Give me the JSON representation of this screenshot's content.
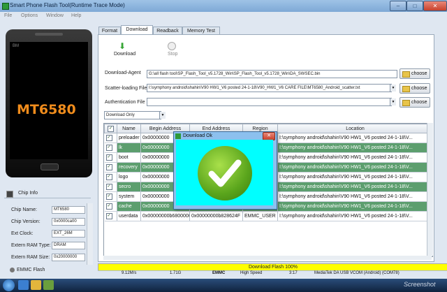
{
  "window": {
    "title": "Smart Phone Flash Tool(Runtime Trace Mode)",
    "minimize": "–",
    "maximize": "□",
    "close": "✕"
  },
  "menu": [
    "File",
    "Options",
    "Window",
    "Help"
  ],
  "phone": {
    "brand": "BM",
    "model": "MT6580"
  },
  "chip_info": {
    "title": "Chip Info",
    "rows": [
      {
        "label": "Chip Name:",
        "value": "MT6580"
      },
      {
        "label": "Chip Version:",
        "value": "0x0000ca00"
      },
      {
        "label": "Ext Clock:",
        "value": "EXT_26M"
      },
      {
        "label": "Extern RAM Type:",
        "value": "DRAM"
      },
      {
        "label": "Extern RAM Size:",
        "value": "0x20000000"
      }
    ],
    "footer": "EMMC Flash"
  },
  "tabs": [
    "Format",
    "Download",
    "Readback",
    "Memory Test"
  ],
  "active_tab": "Download",
  "toolbar": {
    "download": "Download",
    "stop": "Stop",
    "download_icon": "⬇"
  },
  "form": {
    "download_agent": {
      "label": "Download-Agent",
      "value": "G:\\all flash tool\\SP_Flash_Tool_v5.1728_Win\\SP_Flash_Tool_v5.1728_Win\\DA_SWSEC.bin"
    },
    "scatter": {
      "label": "Scatter-loading File",
      "value": "I:\\symphony android\\shahin\\V90 HW1_V6 posted 24-1-18\\V90_HW1_V6 CARE FILE\\MT6580_Android_scatter.txt"
    },
    "auth": {
      "label": "Authentication File",
      "value": ""
    },
    "choose_label": "choose",
    "mode": "Download Only"
  },
  "table": {
    "headers": [
      "",
      "Name",
      "Begin Address",
      "End Address",
      "Region",
      "Location"
    ],
    "rows": [
      {
        "name": "preloader",
        "begin": "0x00000000",
        "end": "",
        "region": "",
        "location": "I:\\symphony android\\shahin\\V90 HW1_V6 posted 24-1-18\\V..."
      },
      {
        "name": "lk",
        "begin": "0x00000000",
        "end": "",
        "region": "",
        "location": "I:\\symphony android\\shahin\\V90 HW1_V6 posted 24-1-18\\V..."
      },
      {
        "name": "boot",
        "begin": "0x00000000",
        "end": "",
        "region": "",
        "location": "I:\\symphony android\\shahin\\V90 HW1_V6 posted 24-1-18\\V..."
      },
      {
        "name": "recovery",
        "begin": "0x00000000",
        "end": "",
        "region": "",
        "location": "I:\\symphony android\\shahin\\V90 HW1_V6 posted 24-1-18\\V..."
      },
      {
        "name": "logo",
        "begin": "0x00000000",
        "end": "",
        "region": "",
        "location": "I:\\symphony android\\shahin\\V90 HW1_V6 posted 24-1-18\\V..."
      },
      {
        "name": "secro",
        "begin": "0x00000000",
        "end": "",
        "region": "",
        "location": "I:\\symphony android\\shahin\\V90 HW1_V6 posted 24-1-18\\V..."
      },
      {
        "name": "system",
        "begin": "0x00000000",
        "end": "",
        "region": "",
        "location": "I:\\symphony android\\shahin\\V90 HW1_V6 posted 24-1-18\\V..."
      },
      {
        "name": "cache",
        "begin": "0x00000000",
        "end": "",
        "region": "",
        "location": "I:\\symphony android\\shahin\\V90 HW1_V6 posted 24-1-18\\V..."
      },
      {
        "name": "userdata",
        "begin": "0x00000000b6800000",
        "end": "0x00000000b828624F",
        "region": "EMMC_USER",
        "location": "I:\\symphony android\\shahin\\V90 HW1_V6 posted 24-1-18\\V..."
      }
    ]
  },
  "dialog": {
    "title": "Download Ok",
    "close": "✕",
    "icon": "✔"
  },
  "status": {
    "progress_text": "Download Flash 100%",
    "progress": 1.0,
    "speed": "9.12M/s",
    "size": "1.71G",
    "storage": "EMMC",
    "mode": "High Speed",
    "time": "3:17",
    "port": "MediaTek DA USB VCOM (Android) (COM78)"
  },
  "watermark": "Screenshot"
}
